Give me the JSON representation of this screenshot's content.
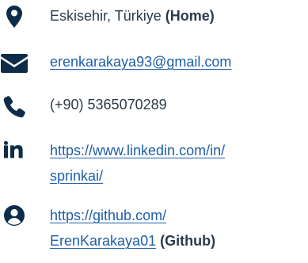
{
  "contacts": {
    "location": {
      "icon": "location-pin-icon",
      "text": "Eskisehir, Türkiye",
      "suffix": "(Home)"
    },
    "email": {
      "icon": "envelope-icon",
      "text": "erenkarakaya93@gmail.com"
    },
    "phone": {
      "icon": "phone-icon",
      "text": "(+90) 5365070289"
    },
    "linkedin": {
      "icon": "linkedin-icon",
      "line1": "https://www.linkedin.com/in/",
      "line2": "sprinkai/"
    },
    "github": {
      "icon": "user-circle-icon",
      "line1": "https://github.com/",
      "line2": "ErenKarakaya01",
      "suffix": "(Github)"
    }
  },
  "colors": {
    "icon": "#0d2c4a",
    "text": "#2b3a4a",
    "link": "#1f5fa8"
  }
}
